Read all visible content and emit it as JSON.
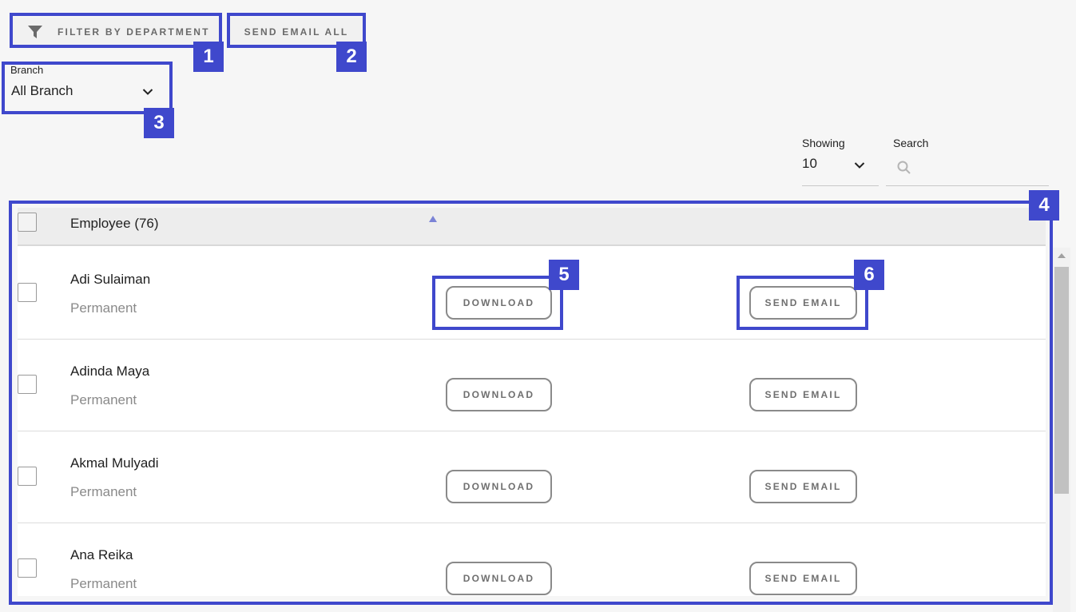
{
  "toolbar": {
    "filter_label": "FILTER BY DEPARTMENT",
    "send_all_label": "SEND EMAIL ALL"
  },
  "branch": {
    "label": "Branch",
    "value": "All Branch"
  },
  "showing": {
    "label": "Showing",
    "value": "10"
  },
  "search": {
    "label": "Search",
    "placeholder": ""
  },
  "table": {
    "header": "Employee (76)",
    "rows": [
      {
        "name": "Adi Sulaiman",
        "type": "Permanent",
        "download_label": "DOWNLOAD",
        "email_label": "SEND EMAIL"
      },
      {
        "name": "Adinda Maya",
        "type": "Permanent",
        "download_label": "DOWNLOAD",
        "email_label": "SEND EMAIL"
      },
      {
        "name": "Akmal Mulyadi",
        "type": "Permanent",
        "download_label": "DOWNLOAD",
        "email_label": "SEND EMAIL"
      },
      {
        "name": "Ana Reika",
        "type": "Permanent",
        "download_label": "DOWNLOAD",
        "email_label": "SEND EMAIL"
      }
    ]
  },
  "annotations": [
    "1",
    "2",
    "3",
    "4",
    "5",
    "6"
  ],
  "colors": {
    "annotation": "#3f48cc",
    "sort_indicator": "#7b83d6"
  },
  "icons": {
    "filter": "funnel-icon",
    "select_chevron": "chevron-down-icon",
    "search": "search-icon",
    "sort": "sort-ascending-icon"
  }
}
